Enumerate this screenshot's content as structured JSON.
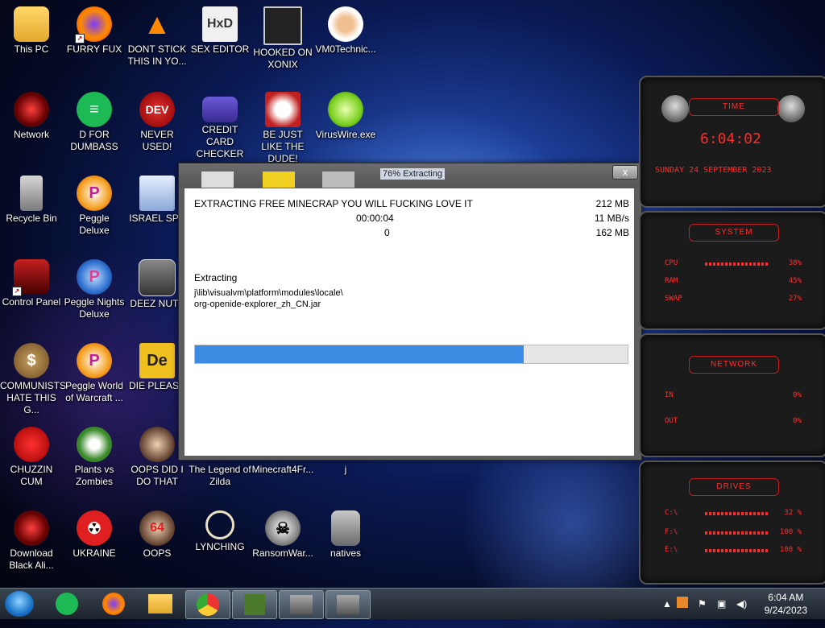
{
  "desktop": {
    "icons": [
      {
        "label": "This PC"
      },
      {
        "label": "FURRY FUX"
      },
      {
        "label": "DONT STICK THIS IN YO..."
      },
      {
        "label": "SEX EDITOR"
      },
      {
        "label": "HOOKED ON XONIX"
      },
      {
        "label": "VM0Technic..."
      },
      {
        "label": "Network"
      },
      {
        "label": "D FOR DUMBASS"
      },
      {
        "label": "NEVER USED!"
      },
      {
        "label": "CREDIT CARD CHECKER"
      },
      {
        "label": "BE JUST LIKE THE DUDE!"
      },
      {
        "label": "VirusWire.exe"
      },
      {
        "label": "Recycle Bin"
      },
      {
        "label": "Peggle Deluxe"
      },
      {
        "label": "ISRAEL SPY"
      },
      {
        "label": "Control Panel"
      },
      {
        "label": "Peggle Nights Deluxe"
      },
      {
        "label": "DEEZ NUTZ"
      },
      {
        "label": "COMMUNISTS HATE THIS G..."
      },
      {
        "label": "Peggle World of Warcraft ..."
      },
      {
        "label": "DIE PLEASE"
      },
      {
        "label": "CHUZZIN CUM"
      },
      {
        "label": "Plants vs Zombies"
      },
      {
        "label": "OOPS DID I DO THAT"
      },
      {
        "label": "The Legend of Zilda"
      },
      {
        "label": "Minecraft4Fr..."
      },
      {
        "label": "j"
      },
      {
        "label": "Download Black Ali..."
      },
      {
        "label": "UKRAINE"
      },
      {
        "label": "OOPS"
      },
      {
        "label": "LYNCHING"
      },
      {
        "label": "RansomWar..."
      },
      {
        "label": "natives"
      }
    ],
    "icon_glyphs": {
      "dev": "DEV",
      "hxd": "HxD",
      "de": "De",
      "p": "P",
      "sixtyfour": "64"
    }
  },
  "extract_window": {
    "title": "76% Extracting",
    "close_glyph": "x",
    "archive_name": "EXTRACTING FREE MINECRAP YOU WILL FUCKING LOVE IT",
    "total_size": "212 MB",
    "elapsed": "00:00:04",
    "speed": "11 MB/s",
    "remaining_count": "0",
    "processed_size": "162 MB",
    "status_label": "Extracting",
    "current_path_line1": "j\\lib\\visualvm\\platform\\modules\\locale\\",
    "current_path_line2": "org-openide-explorer_zh_CN.jar",
    "progress_percent": 76
  },
  "gadget": {
    "time_header": "TIME",
    "time": "6:04:02",
    "date": "SUNDAY 24 SEPTEMBER 2023",
    "system_header": "SYSTEM",
    "cpu_label": "CPU",
    "cpu_value": "38%",
    "ram_label": "RAM",
    "ram_value": "45%",
    "swap_label": "SWAP",
    "swap_value": "27%",
    "network_header": "NETWORK",
    "in_label": "IN",
    "in_value": "0%",
    "out_label": "OUT",
    "out_value": "0%",
    "drives_header": "DRIVES",
    "drives": [
      {
        "label": "C:\\",
        "value": "32 %"
      },
      {
        "label": "F:\\",
        "value": "100 %"
      },
      {
        "label": "E:\\",
        "value": "100 %"
      }
    ],
    "accent_color": "#ff2a2a"
  },
  "taskbar": {
    "clock_time": "6:04 AM",
    "clock_date": "9/24/2023",
    "tray_up_glyph": "▲"
  },
  "colors": {
    "progress_fill": "#3b8be3",
    "window_frame": "#5e5e5e"
  }
}
